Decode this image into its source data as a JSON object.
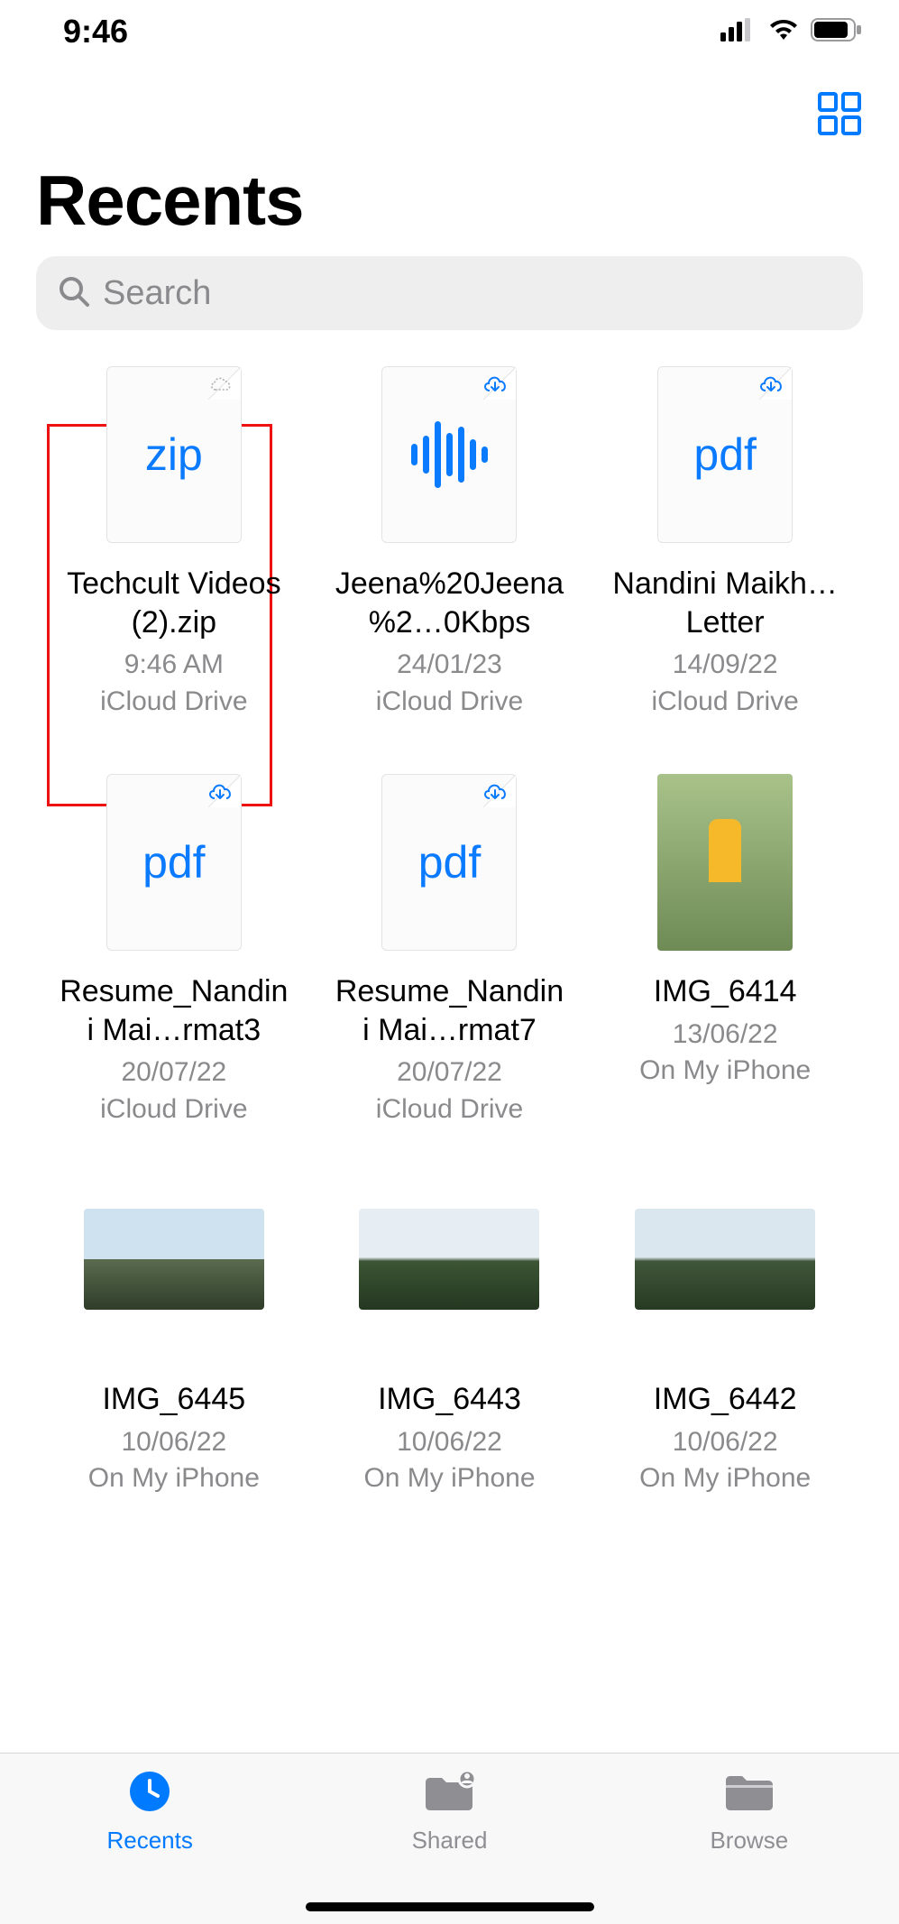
{
  "status_bar": {
    "time": "9:46"
  },
  "header": {
    "title": "Recents",
    "search_placeholder": "Search"
  },
  "files": [
    {
      "name": "Techcult Videos (2).zip",
      "date": "9:46 AM",
      "location": "iCloud Drive",
      "type": "zip",
      "cloud": "dashed"
    },
    {
      "name": "Jeena%20Jeena%2…0Kbps",
      "date": "24/01/23",
      "location": "iCloud Drive",
      "type": "audio",
      "cloud": "download"
    },
    {
      "name": "Nandini Maikh…Letter",
      "date": "14/09/22",
      "location": "iCloud Drive",
      "type": "pdf",
      "cloud": "download"
    },
    {
      "name": "Resume_Nandini Mai…rmat3",
      "date": "20/07/22",
      "location": "iCloud Drive",
      "type": "pdf",
      "cloud": "download"
    },
    {
      "name": "Resume_Nandini Mai…rmat7",
      "date": "20/07/22",
      "location": "iCloud Drive",
      "type": "pdf",
      "cloud": "download"
    },
    {
      "name": "IMG_6414",
      "date": "13/06/22",
      "location": "On My iPhone",
      "type": "photo-portrait"
    },
    {
      "name": "IMG_6445",
      "date": "10/06/22",
      "location": "On My iPhone",
      "type": "photo-landscape",
      "variant": "sky1"
    },
    {
      "name": "IMG_6443",
      "date": "10/06/22",
      "location": "On My iPhone",
      "type": "photo-landscape",
      "variant": "sky2"
    },
    {
      "name": "IMG_6442",
      "date": "10/06/22",
      "location": "On My iPhone",
      "type": "photo-landscape",
      "variant": "sky3"
    }
  ],
  "tabs": {
    "recents": "Recents",
    "shared": "Shared",
    "browse": "Browse"
  }
}
